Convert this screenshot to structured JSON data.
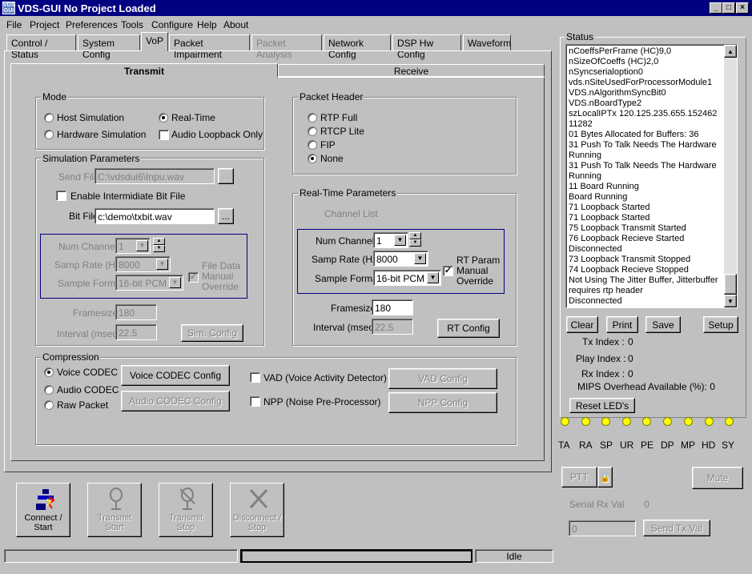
{
  "window": {
    "title": "VDS-GUI No Project Loaded",
    "icon_text": "VDS GUI"
  },
  "menu": [
    "File",
    "Project",
    "Preferences",
    "Tools",
    "Configure",
    "Help",
    "About"
  ],
  "tabs": [
    "Control / Status",
    "System Config",
    "VoP",
    "Packet Impairment",
    "Packet Analysis",
    "Network Config",
    "DSP Hw Config",
    "Waveform"
  ],
  "subtabs": {
    "transmit": "Transmit",
    "receive": "Receive"
  },
  "mode": {
    "label": "Mode",
    "host_sim": "Host Simulation",
    "hw_sim": "Hardware Simulation",
    "realtime": "Real-Time",
    "audio_loopback": "Audio Loopback Only",
    "selected": "Real-Time"
  },
  "sim_params": {
    "label": "Simulation Parameters",
    "send_file_label": "Send File",
    "send_file": "C:\\vdsdui6\\Inpu.wav",
    "enable_bit": "Enable Intermidiate Bit File",
    "bit_file_label": "Bit File",
    "bit_file": "c:\\demo\\txbit.wav",
    "browse": "...",
    "num_channels_label": "Num Channels",
    "num_channels": "1",
    "samp_rate_label": "Samp Rate (Hz)",
    "samp_rate": "8000",
    "sample_format_label": "Sample Format",
    "sample_format": "16-bit PCM",
    "file_override": "File Data Manual Override",
    "framesize_label": "Framesize",
    "framesize": "180",
    "interval_label": "Interval (msec)",
    "interval": "22.5",
    "sim_config": "Sim. Config"
  },
  "packet_header": {
    "label": "Packet Header",
    "options": [
      "RTP  Full",
      "RTCP Lite",
      "FIP",
      "None"
    ],
    "selected": "None"
  },
  "rt_params": {
    "label": "Real-Time Parameters",
    "channel_list": "Channel List",
    "num_channels_label": "Num Channels",
    "num_channels": "1",
    "samp_rate_label": "Samp Rate (Hz)",
    "samp_rate": "8000",
    "sample_format_label": "Sample Format",
    "sample_format": "16-bit PCM",
    "override": "RT Param Manual Override",
    "framesize_label": "Framesize",
    "framesize": "180",
    "interval_label": "Interval (msec)",
    "interval": "22.5",
    "rt_config": "RT Config"
  },
  "compression": {
    "label": "Compression",
    "voice": "Voice CODEC",
    "audio": "Audio CODEC",
    "raw": "Raw Packet",
    "selected": "Voice CODEC",
    "voice_config": "Voice CODEC Config",
    "audio_config": "Audio CODEC Config",
    "vad": "VAD (Voice Activity Detector)",
    "npp": "NPP (Noise Pre-Processor)",
    "vad_config": "VAD Config",
    "npp_config": "NPP Config"
  },
  "status": {
    "label": "Status",
    "lines": [
      "nCoeffsPerFrame (HC)9,0",
      "nSizeOfCoeffs (HC)2,0",
      "nSyncserialoption0",
      "vds.nSiteUsedForProcessorModule1",
      "VDS.nAlgorithmSyncBit0",
      "VDS.nBoardType2",
      "szLocalIPTx 120.125.235.655.152462",
      "11282",
      "01 Bytes Allocated for Buffers: 36",
      "31 Push To Talk Needs The Hardware",
      "Running",
      "31 Push To Talk Needs The Hardware",
      "Running",
      "11 Board Running",
      "Board Running",
      "71 Loopback Started",
      "71 Loopback Started",
      "75 Loopback Transmit Started",
      "76 Loopback Recieve Started",
      "Disconnected",
      "73 Loopback Transmit Stopped",
      "74 Loopback Recieve Stopped",
      "Not Using The Jitter Buffer, Jitterbuffer",
      "requires rtp header",
      "Disconnected"
    ],
    "clear": "Clear",
    "print": "Print",
    "save": "Save",
    "setup": "Setup"
  },
  "indices": {
    "tx_label": "Tx Index :",
    "tx": "0",
    "play_label": "Play Index :",
    "play": "0",
    "rx_label": "Rx Index :",
    "rx": "0",
    "mips": "MIPS Overhead Available (%): 0"
  },
  "reset_leds": "Reset LED's",
  "leds": [
    "TA",
    "RA",
    "SP",
    "UR",
    "PE",
    "DP",
    "MP",
    "HD",
    "SY"
  ],
  "ptt": "PTT",
  "mute": "Mute",
  "serial": {
    "label": "Serial Rx Val",
    "value": "0",
    "tx_value": "0",
    "send": "Send Tx Val"
  },
  "bottom_buttons": {
    "connect": "Connect / Start",
    "tx_start": "Transmit Start",
    "tx_stop": "Transmit Stop",
    "disconnect": "Disconnect / Stop"
  },
  "statusbar": {
    "state": "Idle"
  },
  "colors": {
    "title_bar": "#000080",
    "face": "#c0c0c0",
    "led": "#ffff00"
  }
}
